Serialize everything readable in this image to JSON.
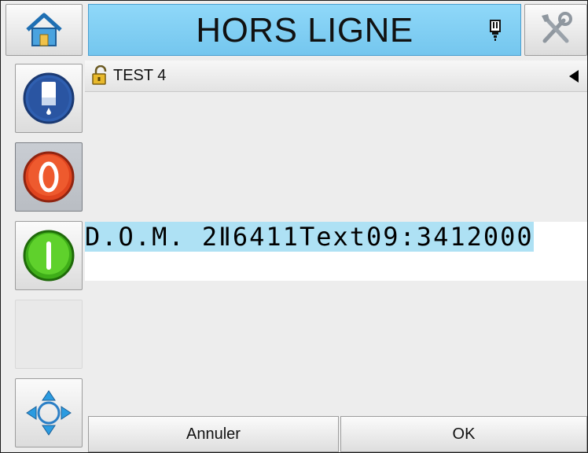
{
  "header": {
    "status": "HORS LIGNE",
    "status_color": "#7fcff4"
  },
  "sidebar": {
    "items": [
      {
        "name": "home",
        "icon": "home-icon"
      },
      {
        "name": "ink",
        "icon": "ink-bottle-icon"
      },
      {
        "name": "stop",
        "icon": "stop-icon",
        "color": "#e0441e",
        "pressed": true
      },
      {
        "name": "start",
        "icon": "start-icon",
        "color": "#47c41c"
      },
      {
        "name": "empty"
      },
      {
        "name": "navigate",
        "icon": "navigation-arrows-icon"
      }
    ],
    "tools_icon": "tools-icon"
  },
  "message": {
    "name": "TEST 4",
    "lock_icon": "padlock-open-icon",
    "collapse_icon": "triangle-left-icon",
    "preview_text": "D.O.M. 2Ⅱ6411Text09:3412000"
  },
  "footer": {
    "cancel_label": "Annuler",
    "ok_label": "OK"
  }
}
